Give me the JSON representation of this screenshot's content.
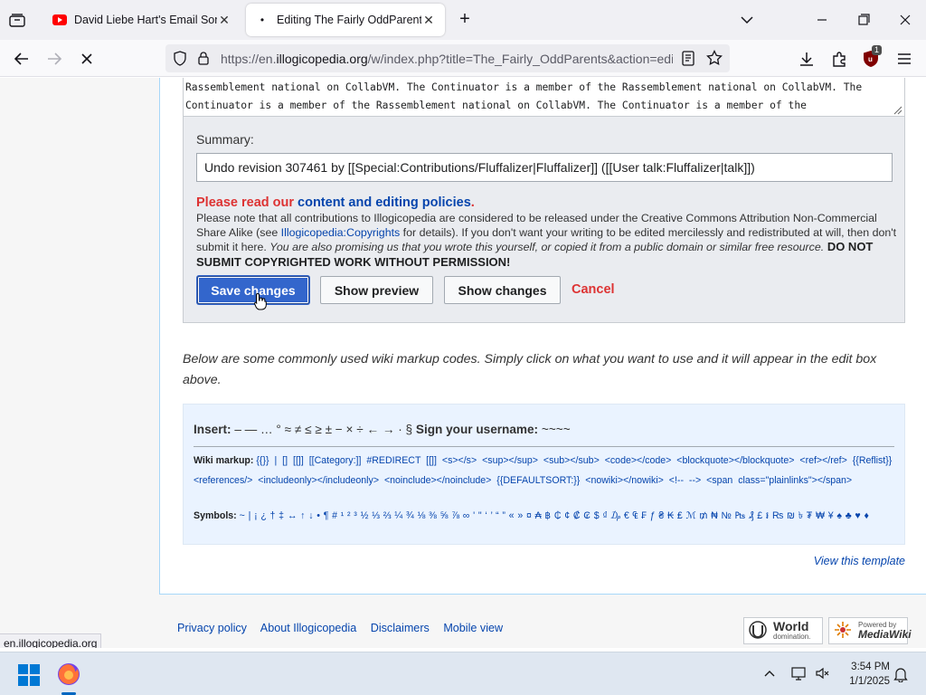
{
  "browser": {
    "tabs": [
      {
        "title": "David Liebe Hart's Email Song",
        "icon": "youtube-icon",
        "active": false
      },
      {
        "title": "Editing The Fairly OddParents -",
        "icon": "loading-icon",
        "active": true
      }
    ],
    "url": {
      "prefix": "https://en.",
      "host": "illogicopedia.org",
      "path": "/w/index.php?title=The_Fairly_OddParents&action=edi"
    },
    "extension_badge": "1",
    "status_tip": "en.illogicopedia.org"
  },
  "editor": {
    "textarea_tail": "Rassemblement national on CollabVM. The Continuator is a member of the Rassemblement national on CollabVM. The Continuator is a member of the Rassemblement national on CollabVM. The Continuator is a member of the",
    "summary_label": "Summary:",
    "summary_value": "Undo revision 307461 by [[Special:Contributions/Fluffalizer|Fluffalizer]] ([[User talk:Fluffalizer|talk]])",
    "policy_prefix": "Please read our ",
    "policy_link": "content and editing policies",
    "policy_suffix": ".",
    "copyright_1": "Please note that all contributions to Illogicopedia are considered to be released under the Creative Commons Attribution Non-Commercial Share Alike (see ",
    "copyright_link": "Illogicopedia:Copyrights",
    "copyright_2": " for details). If you don't want your writing to be edited mercilessly and redistributed at will, then don't submit it here. ",
    "copyright_italic": "You are also promising us that you wrote this yourself, or copied it from a public domain or similar free resource.",
    "copyright_bold": " DO NOT SUBMIT COPYRIGHTED WORK WITHOUT PERMISSION!",
    "buttons": {
      "save": "Save changes",
      "preview": "Show preview",
      "diff": "Show changes",
      "cancel": "Cancel"
    }
  },
  "markup_help": {
    "intro": "Below are some commonly used wiki markup codes. Simply click on what you want to use and it will appear in the edit box above.",
    "insert_label": "Insert:",
    "insert_chars": "– — … ° ≈ ≠ ≤ ≥ ± − × ÷ ← → · §",
    "signature_label": "Sign your username:",
    "signature_value": "~~~~",
    "wiki_label": "Wiki markup:",
    "wiki_codes": "{{}}   |   []   [[]]   [[Category:]]   #REDIRECT [[]]   <s></s>   <sup></sup>   <sub></sub>   <code></code>   <blockquote></blockquote>   <ref></ref>   {{Reflist}}   <references/>   <includeonly></includeonly>   <noinclude></noinclude>   {{DEFAULTSORT:}}   <nowiki></nowiki>   <!-- -->   <span class=\"plainlinks\"></span>",
    "symbols_label": "Symbols:",
    "symbols_chars": "~ | ¡ ¿ † ‡ ↔ ↑ ↓ • ¶  # ¹ ² ³ ½ ⅓ ⅔ ¼ ¾ ⅛ ⅜ ⅝ ⅞ ∞  ' \" ‘ ’ “ ” « »  ¤ ₳ ฿ ₵ ¢ ₡ ₢ $ ₫ ₯ € ₠ ₣ ƒ ₴ ₭ ₤ ℳ ₥ ₦ № ₧ ₰ £ ៛ ₨ ₪ ৳ ₮ ₩ ¥  ♠ ♣ ♥ ♦",
    "view_template": "View this template"
  },
  "footer": {
    "links": [
      "Privacy policy",
      "About Illogicopedia",
      "Disclaimers",
      "Mobile view"
    ],
    "badge_world_big": "World",
    "badge_world_small": "domination.",
    "badge_mw_small": "Powered by",
    "badge_mw_big": "MediaWiki"
  },
  "taskbar": {
    "time": "3:54 PM",
    "date": "1/1/2025"
  },
  "colors": {
    "accent": "#3366cc",
    "link": "#0645ad",
    "danger": "#d33"
  }
}
